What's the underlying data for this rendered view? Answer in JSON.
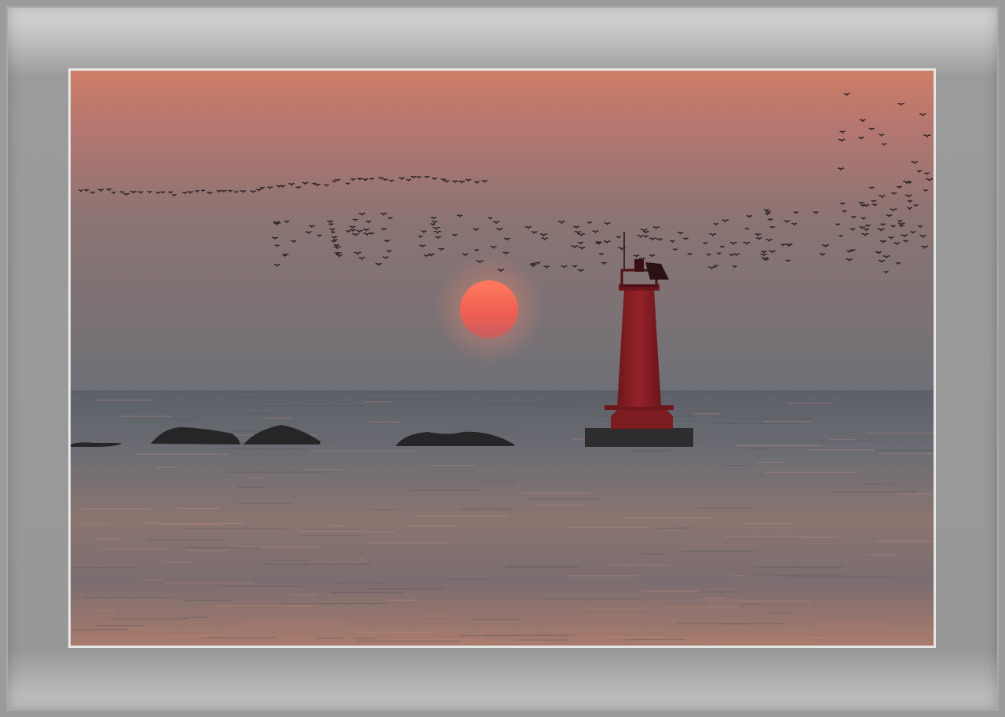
{
  "scene": {
    "colors": {
      "frame_light": "#d9d9d9",
      "frame_mid": "#9b9b9b",
      "mat": "#e6e6e6",
      "sky_top": "#cf7e67",
      "sky_mid": "#8e7473",
      "sky_horizon": "#6e7076",
      "sea": "#6a6d74",
      "sea_reflection": "#b8806f",
      "sun": "#f26a5a",
      "lighthouse": "#8c1f24",
      "rocks": "#2a2a2c",
      "birds": "#2b2426"
    },
    "elements": [
      "sunset-sky",
      "setting-sun",
      "flock-of-birds",
      "red-lighthouse",
      "rocks",
      "sea"
    ]
  }
}
